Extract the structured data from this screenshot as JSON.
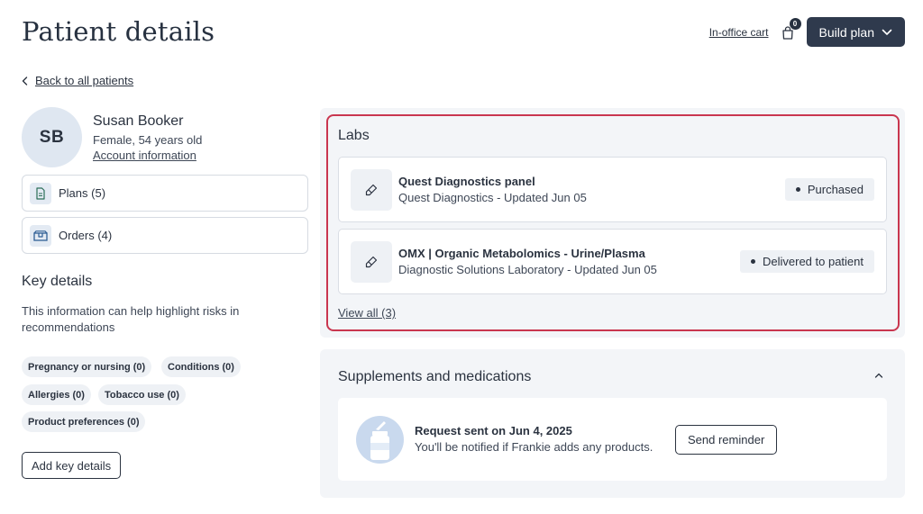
{
  "header": {
    "title": "Patient details",
    "cart_label": "In-office cart",
    "cart_count": "0",
    "build_plan_label": "Build plan"
  },
  "nav": {
    "back_label": "Back to all patients"
  },
  "patient": {
    "initials": "SB",
    "name": "Susan Booker",
    "meta": "Female, 54 years old",
    "account_link": "Account information"
  },
  "sidebar": {
    "plans_label": "Plans (5)",
    "orders_label": "Orders (4)"
  },
  "key_details": {
    "title": "Key details",
    "description": "This information can help highlight risks in recommendations",
    "chips": [
      "Pregnancy or nursing (0)",
      "Conditions (0)",
      "Allergies (0)",
      "Tobacco use (0)",
      "Product preferences (0)"
    ],
    "add_button": "Add key details"
  },
  "labs": {
    "title": "Labs",
    "items": [
      {
        "name": "Quest Diagnostics panel",
        "sub": "Quest Diagnostics - Updated Jun 05",
        "status": "Purchased"
      },
      {
        "name": "OMX | Organic Metabolomics - Urine/Plasma",
        "sub": "Diagnostic Solutions Laboratory - Updated Jun 05",
        "status": "Delivered to patient"
      }
    ],
    "view_all": "View all (3)",
    "highlight_color": "#c9364f"
  },
  "supplements": {
    "title": "Supplements and medications",
    "request_title": "Request sent on Jun 4, 2025",
    "request_sub": "You'll be notified if Frankie adds any products.",
    "reminder_button": "Send reminder"
  },
  "icons": {
    "cart": "shopping-bag-icon",
    "build_plan_chevron": "chevron-down-icon",
    "back": "chevron-left-icon",
    "plans": "document-icon",
    "orders": "box-icon",
    "lab": "pipette-icon",
    "collapse": "chevron-up-icon",
    "bottle": "supplement-bottle-icon"
  },
  "colors": {
    "primary_button": "#2f3a4d",
    "panel_bg": "#f3f5f8",
    "avatar_bg": "#dfe7f1"
  }
}
